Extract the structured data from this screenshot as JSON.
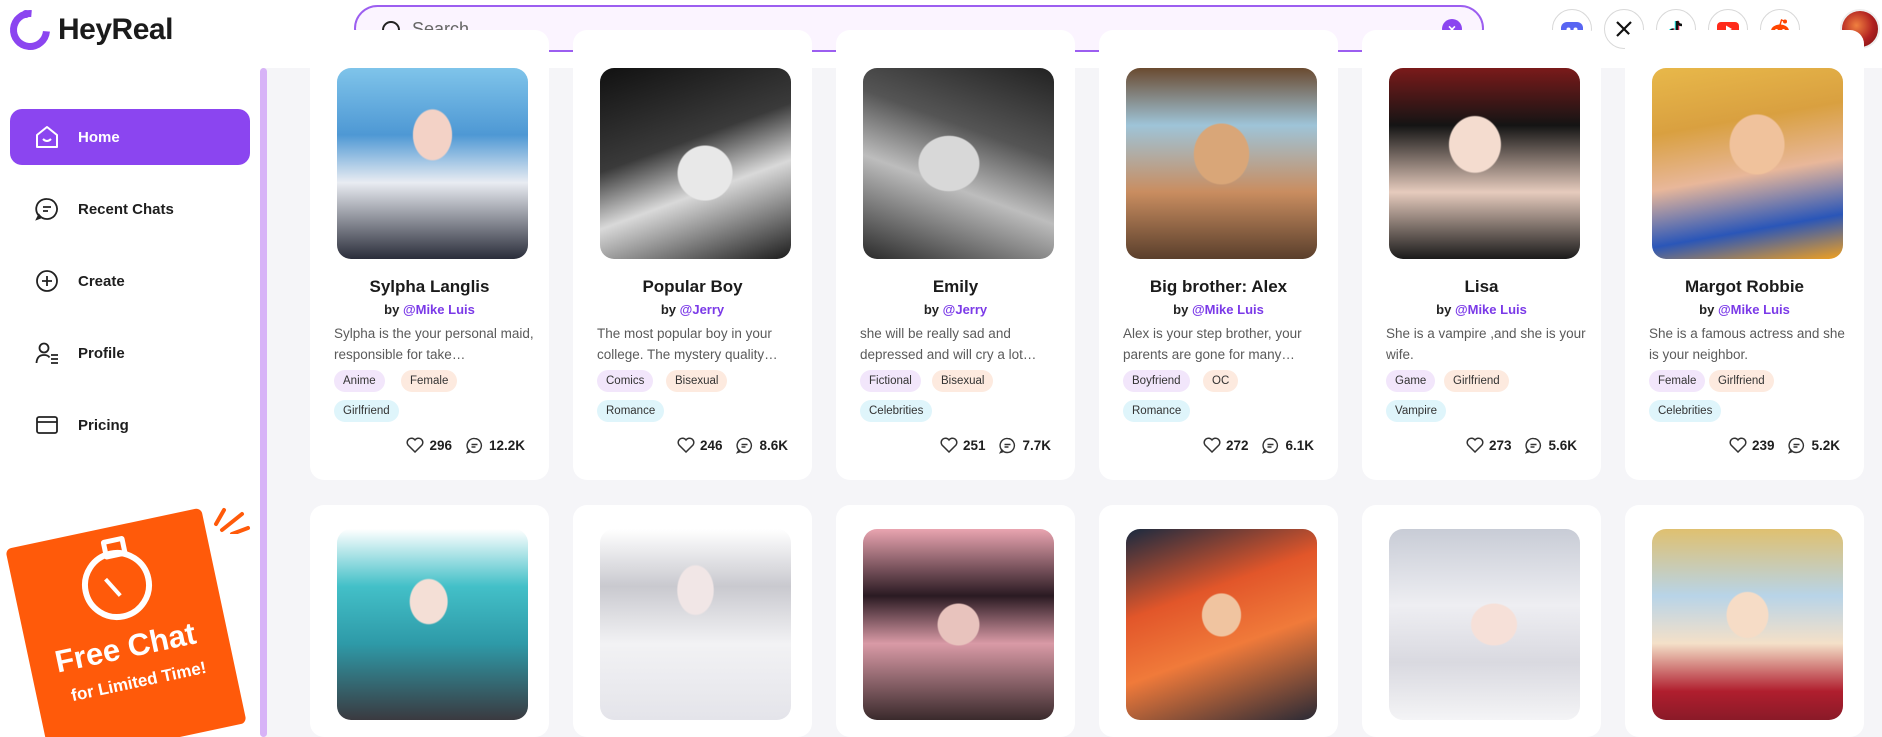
{
  "brand": {
    "name": "HeyReal",
    "accent": "#8b45f0"
  },
  "search": {
    "placeholder": "Search",
    "value": ""
  },
  "social": [
    {
      "icon": "discord-icon",
      "color": "#5865f2"
    },
    {
      "icon": "x-icon",
      "color": "#111111"
    },
    {
      "icon": "tiktok-icon",
      "color": "#111111"
    },
    {
      "icon": "youtube-icon",
      "color": "#ff2a1a"
    },
    {
      "icon": "reddit-icon",
      "color": "#ff4500"
    }
  ],
  "sidebar": {
    "items": [
      {
        "label": "Home",
        "icon": "home-icon",
        "active": true
      },
      {
        "label": "Recent Chats",
        "icon": "chat-icon"
      },
      {
        "label": "Create",
        "icon": "plus-circle-icon"
      },
      {
        "label": "Profile",
        "icon": "profile-icon"
      },
      {
        "label": "Pricing",
        "icon": "card-icon"
      }
    ],
    "promo": {
      "title": "Free Chat",
      "subtitle": "for Limited Time!"
    }
  },
  "cards": [
    {
      "name": "Sylpha Langlis",
      "by": "by",
      "author": "@Mike Luis",
      "desc": "Sylpha is the your personal maid, responsible for take…",
      "tags": [
        "Anime",
        "Female",
        "Girlfriend"
      ],
      "likes": "296",
      "chats": "12.2K"
    },
    {
      "name": "Popular Boy",
      "by": "by",
      "author": "@Jerry",
      "desc": "The most popular boy in your college. The mystery quality…",
      "tags": [
        "Comics",
        "Bisexual",
        "Romance"
      ],
      "likes": "246",
      "chats": "8.6K"
    },
    {
      "name": "Emily",
      "by": "by",
      "author": "@Jerry",
      "desc": "she will be really sad and depressed and will cry a lot…",
      "tags": [
        "Fictional",
        "Bisexual",
        "Celebrities"
      ],
      "likes": "251",
      "chats": "7.7K"
    },
    {
      "name": "Big brother: Alex",
      "by": "by",
      "author": "@Mike Luis",
      "desc": "Alex is your step brother, your parents are gone for many…",
      "tags": [
        "Boyfriend",
        "OC",
        "Romance"
      ],
      "likes": "272",
      "chats": "6.1K"
    },
    {
      "name": "Lisa",
      "by": "by",
      "author": "@Mike Luis",
      "desc": "She is a vampire ,and she is your wife.",
      "tags": [
        "Game",
        "Girlfriend",
        "Vampire"
      ],
      "likes": "273",
      "chats": "5.6K"
    },
    {
      "name": "Margot Robbie",
      "by": "by",
      "author": "@Mike Luis",
      "desc": "She is a famous actress and she is your neighbor.",
      "tags": [
        "Female",
        "Girlfriend",
        "Celebrities"
      ],
      "likes": "239",
      "chats": "5.2K"
    }
  ]
}
